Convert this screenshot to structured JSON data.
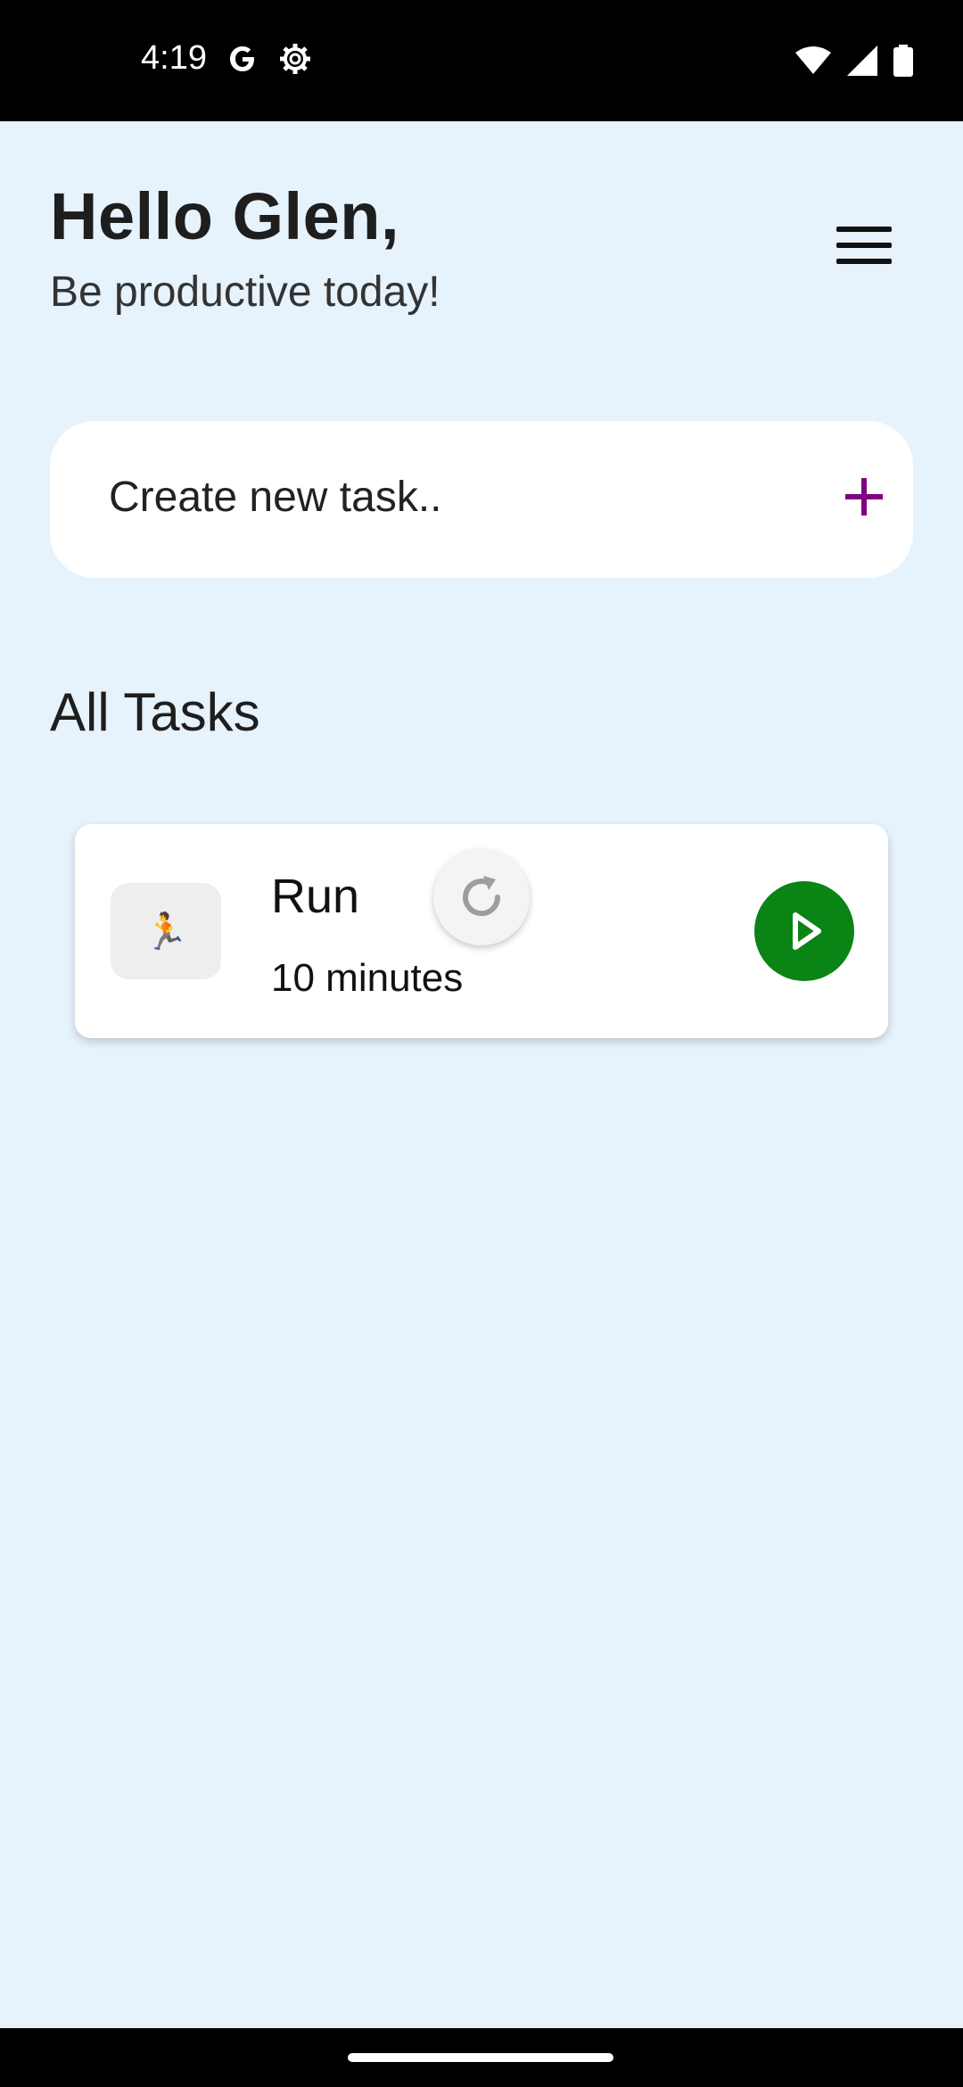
{
  "status_bar": {
    "time": "4:19",
    "icons": [
      "google-icon",
      "settings-gear-icon",
      "wifi-icon",
      "signal-icon",
      "battery-icon"
    ]
  },
  "header": {
    "greeting": "Hello Glen,",
    "subtitle": "Be productive today!",
    "menu_icon": "hamburger-menu-icon"
  },
  "create_task": {
    "placeholder": "Create new task..",
    "add_icon": "plus-icon",
    "accent_color": "#800080"
  },
  "tasks_section": {
    "title": "All Tasks",
    "tasks": [
      {
        "emoji": "🏃",
        "name": "Run",
        "duration": "10 minutes",
        "refresh_icon": "refresh-icon",
        "play_icon": "play-icon",
        "play_color": "#0a8414"
      }
    ]
  },
  "colors": {
    "background": "#e6f2fc",
    "card": "#ffffff"
  }
}
